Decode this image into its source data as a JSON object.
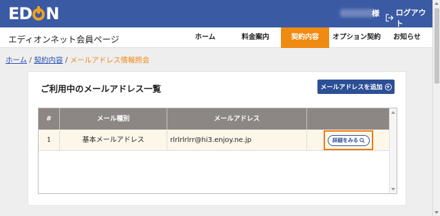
{
  "header": {
    "logo": {
      "left": "ED",
      "right": "N"
    },
    "user_suffix": "様",
    "logout_label": "ログアウト",
    "logout_icon": "logout-arrow-icon"
  },
  "nav": {
    "site_title": "エディオンネット会員ページ",
    "items": [
      {
        "label": "ホーム",
        "active": false
      },
      {
        "label": "料金案内",
        "active": false
      },
      {
        "label": "契約内容",
        "active": true
      },
      {
        "label": "オプション契約",
        "active": false
      },
      {
        "label": "お知らせ",
        "active": false
      }
    ]
  },
  "breadcrumb": {
    "home": "ホーム",
    "sep1": "/",
    "contract": "契約内容",
    "sep2": "/",
    "current": "メールアドレス情報照会"
  },
  "panel": {
    "title": "ご利用中のメールアドレス一覧",
    "add_button": "メールアドレスを追加",
    "add_icon": "plus-circle-icon"
  },
  "table": {
    "headers": [
      "#",
      "メール種別",
      "メールアドレス",
      ""
    ],
    "rows": [
      {
        "num": "1",
        "type": "基本メールアドレス",
        "address": "rlrlrlrlrr@hi3.enjoy.ne.jp",
        "action": "詳細をみる",
        "action_icon": "search-icon"
      }
    ]
  },
  "colors": {
    "header_bg": "#3a5aa3",
    "accent_orange": "#ef8a12",
    "button_blue": "#2d4f96",
    "table_header": "#8c8784",
    "row_bg": "#fdf7ea"
  }
}
